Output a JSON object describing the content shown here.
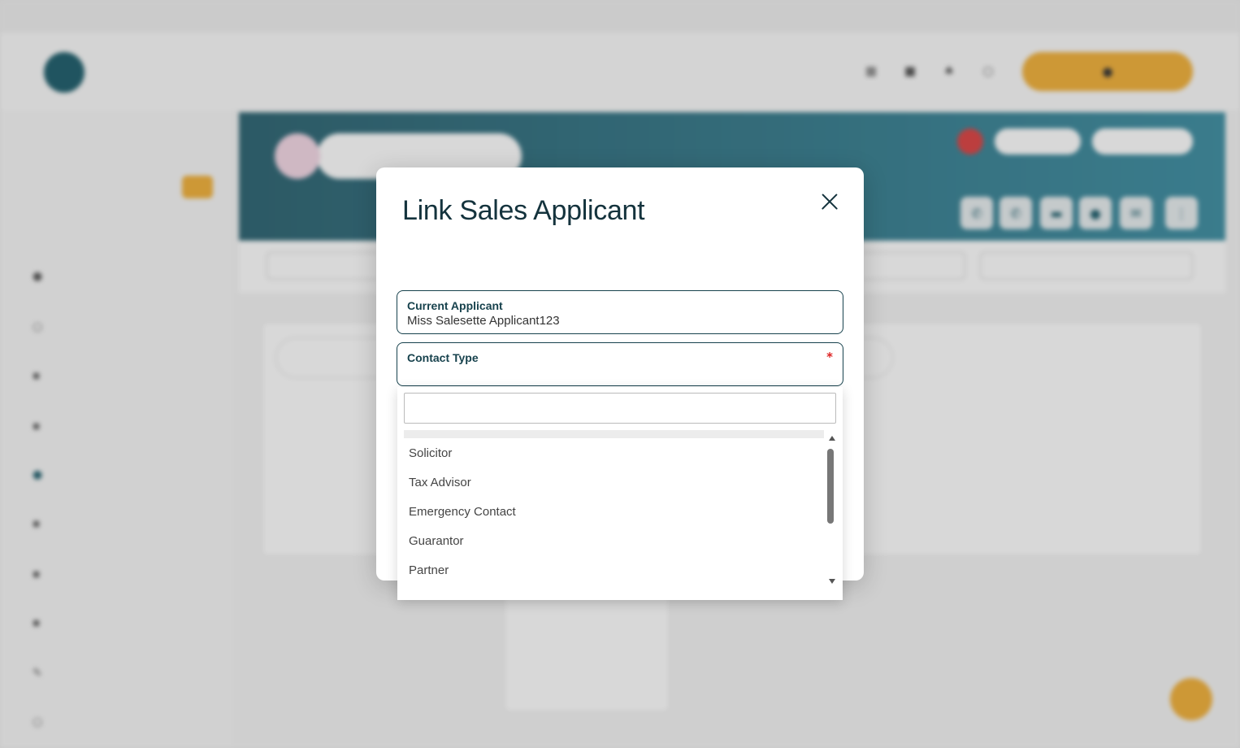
{
  "modal": {
    "title": "Link Sales Applicant",
    "current_applicant": {
      "label": "Current Applicant",
      "value": "Miss Salesette Applicant123"
    },
    "contact_type": {
      "label": "Contact Type",
      "required_marker": "*",
      "value": ""
    }
  },
  "dropdown": {
    "search_value": "",
    "options": [
      "Solicitor",
      "Tax Advisor",
      "Emergency Contact",
      "Guarantor",
      "Partner"
    ]
  },
  "colors": {
    "brand_dark": "#14333d",
    "accent": "#f2b13a",
    "required": "#dd2222"
  }
}
